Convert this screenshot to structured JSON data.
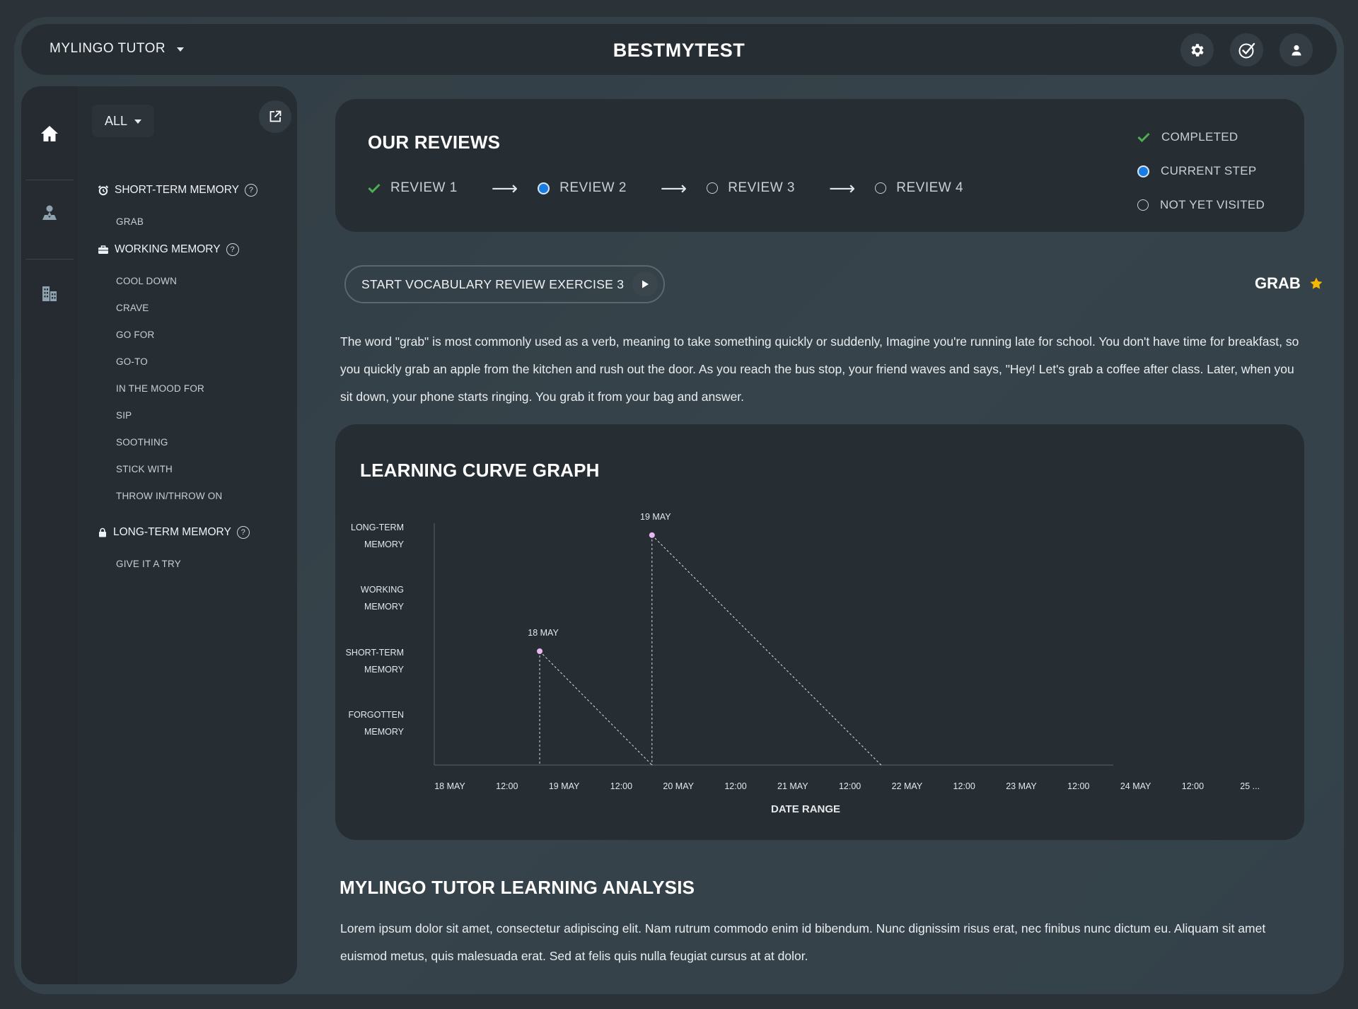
{
  "header": {
    "app_name": "MYLINGO TUTOR",
    "brand": "BESTMYTEST",
    "icons": [
      "gear-icon",
      "check-circle-icon",
      "user-icon"
    ]
  },
  "sidebar": {
    "rail_icons": [
      "home-icon",
      "map-person-icon",
      "buildings-icon"
    ],
    "filter_label": "ALL",
    "groups": [
      {
        "label": "SHORT-TERM MEMORY",
        "icon": "alarm-clock-icon",
        "items": [
          "GRAB"
        ]
      },
      {
        "label": "WORKING MEMORY",
        "icon": "briefcase-icon",
        "items": [
          "COOL DOWN",
          "CRAVE",
          "GO FOR",
          "GO-TO",
          "IN THE MOOD FOR",
          "SIP",
          "SOOTHING",
          "STICK WITH",
          "THROW IN/THROW ON"
        ]
      },
      {
        "label": "LONG-TERM MEMORY",
        "icon": "lock-icon",
        "items": [
          "GIVE IT A TRY"
        ]
      }
    ]
  },
  "reviews": {
    "title": "OUR REVIEWS",
    "steps": [
      {
        "label": "REVIEW 1",
        "state": "completed"
      },
      {
        "label": "REVIEW 2",
        "state": "current"
      },
      {
        "label": "REVIEW 3",
        "state": "not_visited"
      },
      {
        "label": "REVIEW 4",
        "state": "not_visited"
      }
    ],
    "legend": [
      {
        "label": "COMPLETED",
        "state": "completed"
      },
      {
        "label": "CURRENT STEP",
        "state": "current"
      },
      {
        "label": "NOT YET VISITED",
        "state": "not_visited"
      }
    ]
  },
  "exercise": {
    "start_label": "START VOCABULARY REVIEW EXERCISE 3",
    "word": "GRAB",
    "description": "The word \"grab\" is most commonly used as a verb, meaning to take something quickly or suddenly, Imagine you're running late for school. You don't have time for breakfast, so you quickly grab an apple from the kitchen and rush out the door. As you reach the bus stop, your friend waves and says, \"Hey! Let's grab a coffee after class. Later, when you sit down, your phone starts ringing. You grab it from your bag and answer."
  },
  "colors": {
    "completed": "#4caf50",
    "current": "#1a7be0",
    "star": "#f5b800",
    "point": "#e9b6f0"
  },
  "chart_data": {
    "type": "line",
    "title": "LEARNING CURVE GRAPH",
    "xlabel": "DATE RANGE",
    "ylabel": "",
    "y_levels": [
      "FORGOTTEN MEMORY",
      "SHORT-TERM MEMORY",
      "WORKING MEMORY",
      "LONG-TERM MEMORY"
    ],
    "x_tick_labels": [
      "18 MAY",
      "12:00",
      "19 MAY",
      "12:00",
      "20 MAY",
      "12:00",
      "21 MAY",
      "12:00",
      "22 MAY",
      "12:00",
      "23 MAY",
      "12:00",
      "24 MAY",
      "12:00",
      "25 ..."
    ],
    "x_range_days": [
      0,
      7.2
    ],
    "points": [
      {
        "label": "18 MAY",
        "x_day": 0.92,
        "level": 1.5,
        "point_label": "18 MAY"
      },
      {
        "label": "19 MAY",
        "x_day": 1.9,
        "level": 3.35,
        "point_label": "19 MAY"
      }
    ],
    "decays": [
      {
        "from_day": 0.92,
        "to_day": 1.9,
        "from_level": 1.5,
        "to_level": 0
      },
      {
        "from_day": 1.9,
        "to_day": 3.9,
        "from_level": 3.35,
        "to_level": 0
      }
    ]
  },
  "analysis": {
    "title": "MYLINGO TUTOR LEARNING ANALYSIS",
    "text": "Lorem ipsum dolor sit amet, consectetur adipiscing elit. Nam rutrum commodo enim id bibendum. Nunc dignissim risus erat, nec finibus nunc dictum eu. Aliquam sit amet euismod metus, quis malesuada erat. Sed at felis quis nulla feugiat cursus at at dolor."
  }
}
